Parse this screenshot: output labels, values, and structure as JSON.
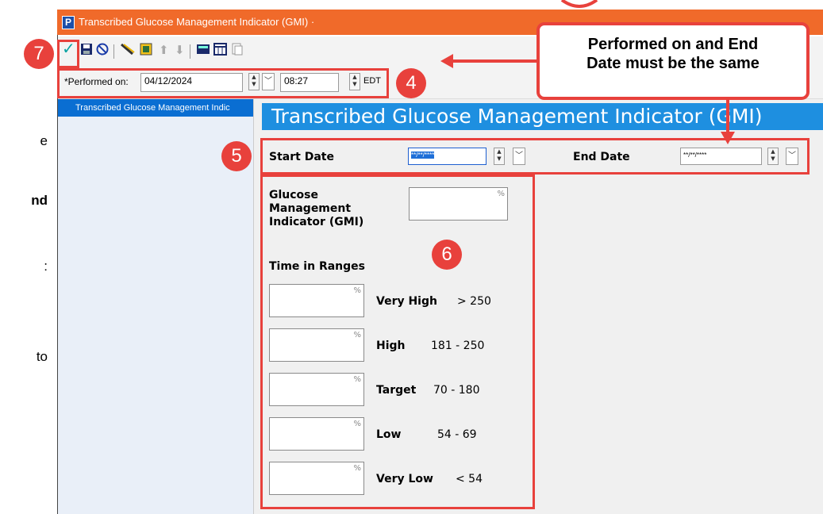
{
  "doc_fragments": [
    "e",
    "nd",
    ":",
    "to"
  ],
  "window": {
    "app_icon_letter": "P",
    "title": "Transcribed Glucose Management Indicator (GMI) ·"
  },
  "toolbar": {
    "icons": [
      "checkmark-icon",
      "save-icon",
      "cancel-icon",
      "reference-icon",
      "form-browser-icon",
      "up-arrow-icon",
      "down-arrow-icon",
      "calculator-icon",
      "calendar-icon",
      "copy-icon"
    ]
  },
  "performed": {
    "label": "*Performed on:",
    "date": "04/12/2024",
    "time": "08:27",
    "timezone": "EDT"
  },
  "sidebar": {
    "selected_item": "Transcribed Glucose Management Indic"
  },
  "form": {
    "header": "Transcribed Glucose Management Indicator (GMI)",
    "start_date_label": "Start Date",
    "start_date_value": "**/**/****",
    "end_date_label": "End Date",
    "end_date_value": "**/**/****",
    "gmi_label_line1": "Glucose",
    "gmi_label_line2": "Management",
    "gmi_label_line3": "Indicator (GMI)",
    "percent": "%",
    "time_in_ranges_label": "Time in Ranges",
    "ranges": [
      {
        "label": "Very High",
        "range": "> 250"
      },
      {
        "label": "High",
        "range": "181 - 250"
      },
      {
        "label": "Target",
        "range": "70 - 180"
      },
      {
        "label": "Low",
        "range": "54 - 69"
      },
      {
        "label": "Very Low",
        "range": "< 54"
      }
    ]
  },
  "annotations": {
    "callout_line1": "Performed on and End",
    "callout_line2": "Date must be the same",
    "badge_4": "4",
    "badge_5": "5",
    "badge_6": "6",
    "badge_7": "7",
    "accent_color": "#e8413c"
  }
}
